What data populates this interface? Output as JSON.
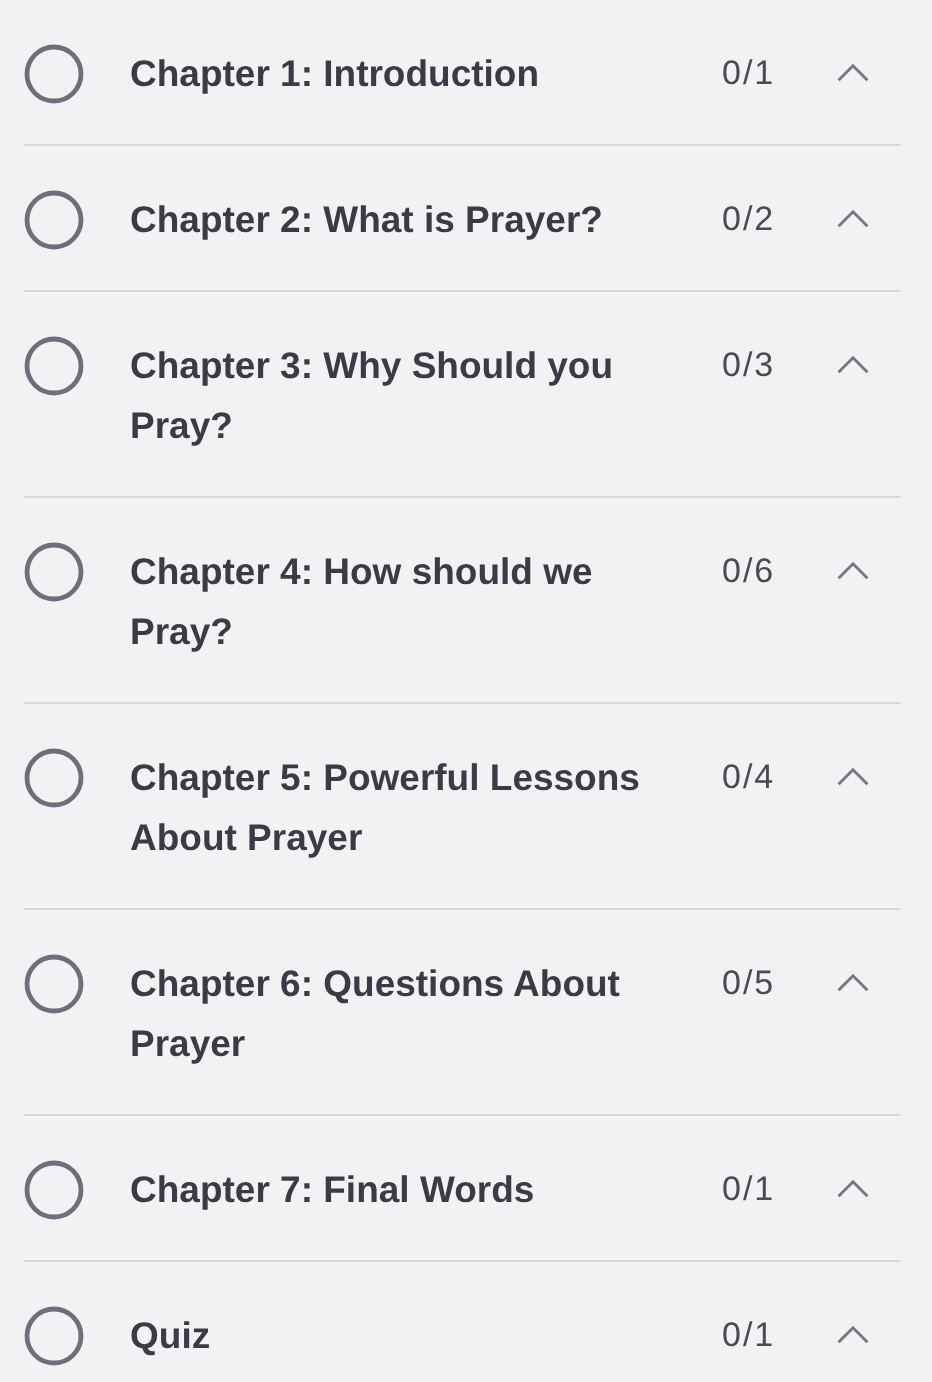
{
  "chapters": [
    {
      "title": "Chapter 1: Introduction",
      "count": "0/1",
      "completed": false
    },
    {
      "title": "Chapter 2: What is Prayer?",
      "count": "0/2",
      "completed": false
    },
    {
      "title": "Chapter 3: Why Should you Pray?",
      "count": "0/3",
      "completed": false
    },
    {
      "title": "Chapter 4: How should we Pray?",
      "count": "0/6",
      "completed": false
    },
    {
      "title": "Chapter 5: Powerful Lessons About Prayer",
      "count": "0/4",
      "completed": false
    },
    {
      "title": "Chapter 6: Questions About Prayer",
      "count": "0/5",
      "completed": false
    },
    {
      "title": "Chapter 7: Final Words",
      "count": "0/1",
      "completed": false
    },
    {
      "title": "Quiz",
      "count": "0/1",
      "completed": false
    }
  ]
}
